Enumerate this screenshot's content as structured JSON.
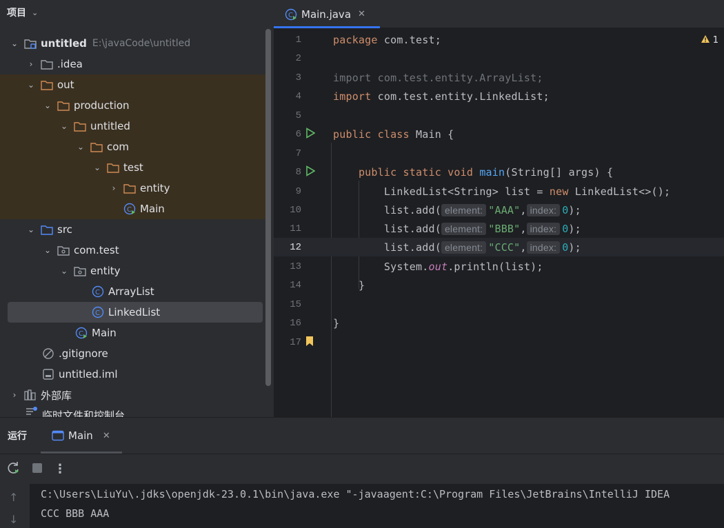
{
  "project_panel": {
    "title": "项目"
  },
  "tree": [
    {
      "label": "untitled",
      "path": "E:\\javaCode\\untitled"
    },
    {
      "label": ".idea"
    },
    {
      "label": "out"
    },
    {
      "label": "production"
    },
    {
      "label": "untitled"
    },
    {
      "label": "com"
    },
    {
      "label": "test"
    },
    {
      "label": "entity"
    },
    {
      "label": "Main"
    },
    {
      "label": "src"
    },
    {
      "label": "com.test"
    },
    {
      "label": "entity"
    },
    {
      "label": "ArrayList"
    },
    {
      "label": "LinkedList"
    },
    {
      "label": "Main"
    },
    {
      "label": ".gitignore"
    },
    {
      "label": "untitled.iml"
    },
    {
      "label": "外部库"
    },
    {
      "label": "临时文件和控制台"
    }
  ],
  "editor": {
    "tab": "Main.java",
    "warnings": "1",
    "line_numbers": [
      "1",
      "2",
      "3",
      "4",
      "5",
      "6",
      "7",
      "8",
      "9",
      "10",
      "11",
      "12",
      "13",
      "14",
      "15",
      "16",
      "17"
    ],
    "code": {
      "l1_kw": "package",
      "l1_rest": " com.test;",
      "l3": "import com.test.entity.ArrayList;",
      "l4_kw": "import",
      "l4_rest": " com.test.entity.LinkedList;",
      "l6_kw": "public class",
      "l6_rest": " Main {",
      "l8_kw": "public static void",
      "l8_fn": "main",
      "l8_rest": "(String[] args) {",
      "l9_a": "LinkedList<String> list = ",
      "l9_kw": "new",
      "l9_b": " LinkedList<>();",
      "add_call": "list.add(",
      "hint_element": "element:",
      "hint_index": "index:",
      "s1": "\"AAA\"",
      "s2": "\"BBB\"",
      "s3": "\"CCC\"",
      "comma": ",",
      "zero": "0",
      "close": ");",
      "l13_a": "System.",
      "l13_fld": "out",
      "l13_b": ".println(list);",
      "brace": "}"
    }
  },
  "run_panel": {
    "title": "运行",
    "tab": "Main",
    "console_lines": [
      "C:\\Users\\LiuYu\\.jdks\\openjdk-23.0.1\\bin\\java.exe \"-javaagent:C:\\Program Files\\JetBrains\\IntelliJ IDEA",
      "CCC BBB AAA"
    ]
  },
  "colors": {
    "accent": "#3574f0",
    "folder_out": "#d08a54",
    "folder_src": "#548af7",
    "class_icon": "#548af7",
    "run_green": "#5fb865",
    "bookmark": "#f2c55c"
  }
}
